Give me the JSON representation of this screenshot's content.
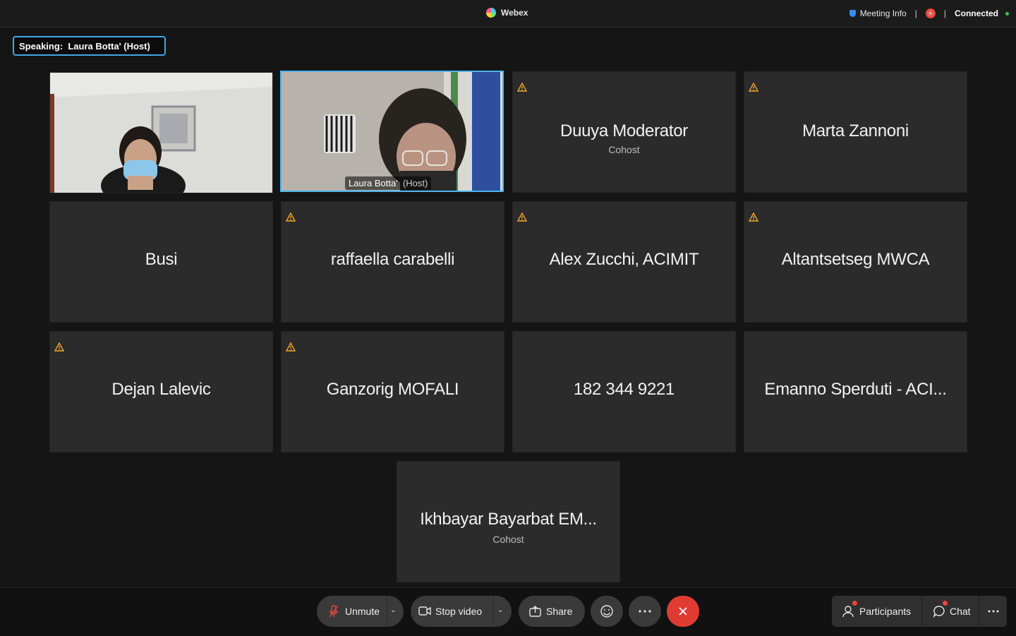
{
  "titlebar": {
    "app_title": "Webex",
    "meeting_info_label": "Meeting Info",
    "separator": "|",
    "connection_status": "Connected"
  },
  "speaking_label": "Speaking:  Laura Botta' (Host)",
  "participants": [
    {
      "name": "",
      "role": "",
      "video": true
    },
    {
      "name": "Laura Botta'",
      "role": "(Host)",
      "video": true,
      "active_speaker": true
    },
    {
      "name": "Duuya Moderator",
      "role": "Cohost",
      "warning": true
    },
    {
      "name": "Marta Zannoni",
      "role": "",
      "warning": true
    },
    {
      "name": "Busi",
      "role": ""
    },
    {
      "name": "raffaella carabelli",
      "role": "",
      "warning": true
    },
    {
      "name": "Alex Zucchi, ACIMIT",
      "role": "",
      "warning": true
    },
    {
      "name": "Altantsetseg MWCA",
      "role": "",
      "warning": true
    },
    {
      "name": "Dejan Lalevic",
      "role": "",
      "warning": true
    },
    {
      "name": "Ganzorig MOFALI",
      "role": "",
      "warning": true
    },
    {
      "name": "182 344 9221",
      "role": ""
    },
    {
      "name": "Emanno Sperduti - ACI...",
      "role": ""
    },
    {
      "name": "Ikhbayar Bayarbat EM...",
      "role": "Cohost"
    }
  ],
  "toolbar": {
    "unmute": "Unmute",
    "stop_video": "Stop video",
    "share": "Share",
    "participants": "Participants",
    "chat": "Chat"
  },
  "colors": {
    "accent_blue": "#3fa7e6",
    "end_call_red": "#e03b32",
    "warning_orange": "#f5a623",
    "connected_green": "#34c759"
  }
}
